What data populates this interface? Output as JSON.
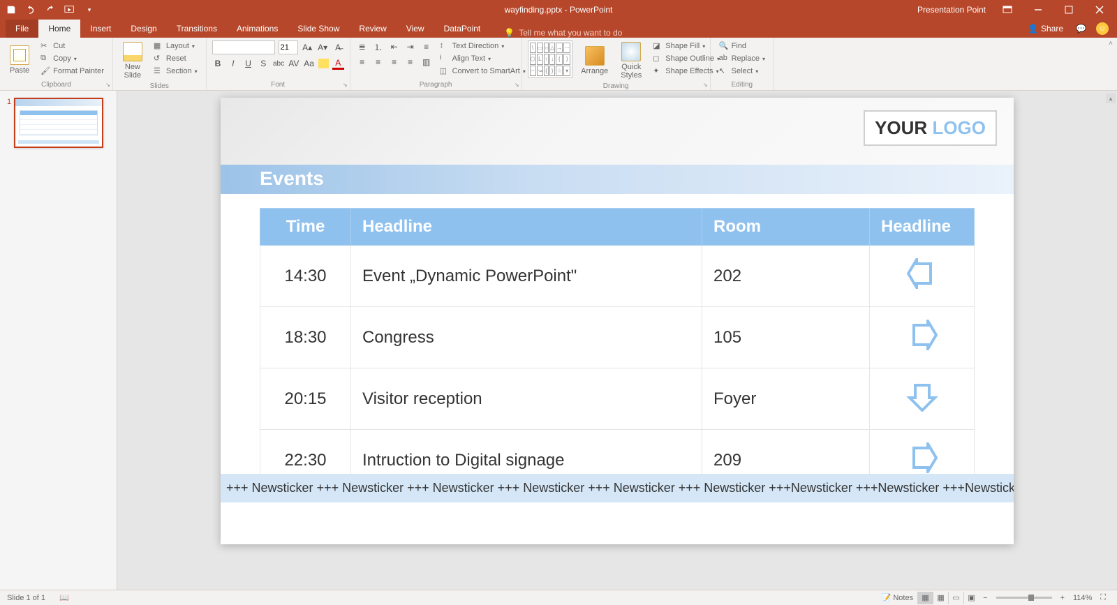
{
  "titlebar": {
    "filename": "wayfinding.pptx - PowerPoint",
    "presentation_point": "Presentation Point"
  },
  "tabs": {
    "file": "File",
    "home": "Home",
    "insert": "Insert",
    "design": "Design",
    "transitions": "Transitions",
    "animations": "Animations",
    "slideshow": "Slide Show",
    "review": "Review",
    "view": "View",
    "datapoint": "DataPoint",
    "tellme": "Tell me what you want to do",
    "share": "Share"
  },
  "ribbon": {
    "clipboard": {
      "label": "Clipboard",
      "paste": "Paste",
      "cut": "Cut",
      "copy": "Copy",
      "format_painter": "Format Painter"
    },
    "slides": {
      "label": "Slides",
      "new_slide": "New\nSlide",
      "layout": "Layout",
      "reset": "Reset",
      "section": "Section"
    },
    "font": {
      "label": "Font",
      "size_value": "21"
    },
    "paragraph": {
      "label": "Paragraph",
      "text_direction": "Text Direction",
      "align_text": "Align Text",
      "convert_smartart": "Convert to SmartArt"
    },
    "drawing": {
      "label": "Drawing",
      "arrange": "Arrange",
      "quick_styles": "Quick\nStyles",
      "shape_fill": "Shape Fill",
      "shape_outline": "Shape Outline",
      "shape_effects": "Shape Effects"
    },
    "editing": {
      "label": "Editing",
      "find": "Find",
      "replace": "Replace",
      "select": "Select"
    }
  },
  "thumbnail": {
    "number": "1"
  },
  "slide": {
    "logo": {
      "word1": "YOUR ",
      "word2": "LOGO"
    },
    "events_title": "Events",
    "headers": {
      "time": "Time",
      "headline": "Headline",
      "room": "Room",
      "headline2": "Headline"
    },
    "rows": [
      {
        "time": "14:30",
        "headline": "Event „Dynamic PowerPoint\"",
        "room": "202",
        "dir": "left"
      },
      {
        "time": "18:30",
        "headline": "Congress",
        "room": "105",
        "dir": "right"
      },
      {
        "time": "20:15",
        "headline": "Visitor reception",
        "room": "Foyer",
        "dir": "down"
      },
      {
        "time": "22:30",
        "headline": "Intruction to Digital signage",
        "room": "209",
        "dir": "right"
      }
    ],
    "newsticker": "+++ Newsticker +++ Newsticker +++ Newsticker +++ Newsticker +++ Newsticker +++ Newsticker +++Newsticker +++Newsticker +++Newsticker +++"
  },
  "statusbar": {
    "slide_info": "Slide 1 of 1",
    "notes": "Notes",
    "zoom": "114%"
  }
}
